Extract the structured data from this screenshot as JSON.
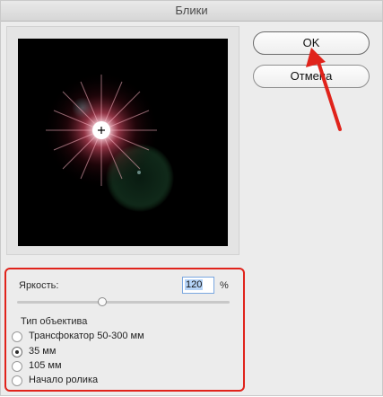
{
  "dialog": {
    "title": "Блики",
    "ok_label": "OK",
    "cancel_label": "Отмена"
  },
  "brightness": {
    "label": "Яркость:",
    "value": "120",
    "unit": "%",
    "slider_fraction": 0.4
  },
  "lens_type": {
    "group_label": "Тип объектива",
    "options": [
      {
        "label": "Трансфокатор 50-300 мм",
        "selected": false
      },
      {
        "label": "35 мм",
        "selected": true
      },
      {
        "label": "105 мм",
        "selected": false
      },
      {
        "label": "Начало ролика",
        "selected": false
      }
    ]
  },
  "colors": {
    "highlight_red": "#e0231b",
    "flare_core": "#ffffff",
    "flare_glow": "#ff5a78",
    "ghost_green": "#2f7a46"
  }
}
